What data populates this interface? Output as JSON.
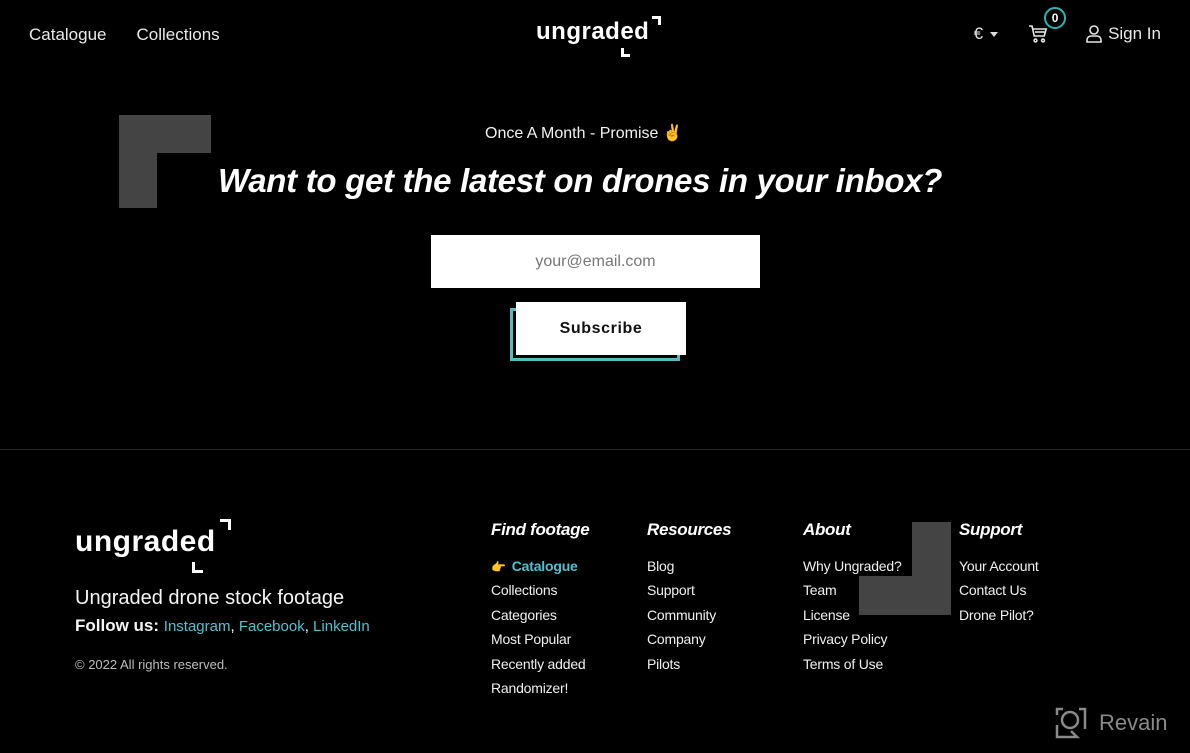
{
  "header": {
    "nav": [
      {
        "label": "Catalogue"
      },
      {
        "label": "Collections"
      }
    ],
    "logo": "ungraded",
    "currency": "€",
    "cart_count": "0",
    "sign_in": "Sign In",
    "icons": {
      "currency_caret": "chevron-down-icon",
      "cart": "cart-icon",
      "user": "user-icon"
    }
  },
  "newsletter": {
    "tagline": "Once A Month - Promise ✌",
    "headline": "Want to get the latest on drones in your inbox?",
    "email_placeholder": "your@email.com",
    "email_value": "",
    "subscribe_label": "Subscribe"
  },
  "footer": {
    "logo": "ungraded",
    "tagline": "Ungraded drone stock footage",
    "follow_label": "Follow us:",
    "social": [
      {
        "label": "Instagram"
      },
      {
        "label": "Facebook"
      },
      {
        "label": "LinkedIn"
      }
    ],
    "copyright": "© 2022 All rights reserved.",
    "columns": [
      {
        "title": "Find footage",
        "items": [
          {
            "label": "Catalogue",
            "active": true,
            "icon": "👉"
          },
          {
            "label": "Collections"
          },
          {
            "label": "Categories"
          },
          {
            "label": "Most Popular"
          },
          {
            "label": "Recently added"
          },
          {
            "label": "Randomizer!"
          }
        ]
      },
      {
        "title": "Resources",
        "items": [
          {
            "label": "Blog"
          },
          {
            "label": "Support"
          },
          {
            "label": "Community"
          },
          {
            "label": "Company"
          },
          {
            "label": "Pilots"
          }
        ]
      },
      {
        "title": "About",
        "items": [
          {
            "label": "Why Ungraded?"
          },
          {
            "label": "Team"
          },
          {
            "label": "License"
          },
          {
            "label": "Privacy Policy"
          },
          {
            "label": "Terms of Use"
          }
        ]
      },
      {
        "title": "Support",
        "items": [
          {
            "label": "Your Account"
          },
          {
            "label": "Contact Us"
          },
          {
            "label": "Drone Pilot?"
          }
        ]
      }
    ]
  },
  "watermark": {
    "label": "Revain"
  },
  "colors": {
    "accent": "#4fc1cf",
    "badge_ring": "#2fb3b0",
    "subscribe_shadow": "#5ab9be",
    "deco_block": "#444444"
  }
}
